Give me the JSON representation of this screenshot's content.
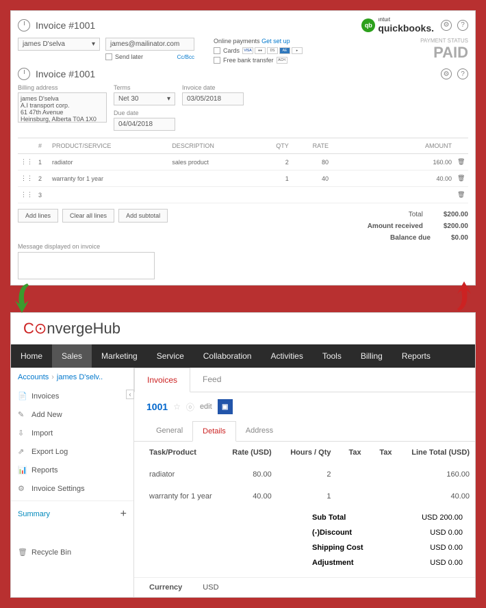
{
  "qb": {
    "title": "Invoice #1001",
    "logo": {
      "badge": "qb",
      "text1": "ıntuıt",
      "text2": "quickbooks."
    },
    "customer": "james D'selva",
    "email": "james@mailinator.com",
    "send_later": "Send later",
    "ccbcc": "Cc/Bcc",
    "online": {
      "title": "Online payments",
      "link": "Get set up",
      "cards_label": "Cards",
      "bank_label": "Free bank transfer"
    },
    "status_label": "PAYMENT STATUS",
    "status_value": "PAID",
    "billing_label": "Billing address",
    "billing_value": "james D'selva\nA.I transport corp.\n61 47th Avenue\nHeinsburg, Alberta  T0A 1X0",
    "terms_label": "Terms",
    "terms_value": "Net 30",
    "invoice_date_label": "Invoice date",
    "invoice_date": "03/05/2018",
    "due_date_label": "Due date",
    "due_date": "04/04/2018",
    "cols": {
      "num": "#",
      "prod": "PRODUCT/SERVICE",
      "desc": "DESCRIPTION",
      "qty": "QTY",
      "rate": "RATE",
      "amount": "AMOUNT"
    },
    "lines": [
      {
        "n": "1",
        "prod": "radiator",
        "desc": "sales product",
        "qty": "2",
        "rate": "80",
        "amount": "160.00"
      },
      {
        "n": "2",
        "prod": "warranty for 1 year",
        "desc": "",
        "qty": "1",
        "rate": "40",
        "amount": "40.00"
      },
      {
        "n": "3",
        "prod": "",
        "desc": "",
        "qty": "",
        "rate": "",
        "amount": ""
      }
    ],
    "btn_add_lines": "Add lines",
    "btn_clear": "Clear all lines",
    "btn_subtotal": "Add subtotal",
    "totals": {
      "total_label": "Total",
      "total": "$200.00",
      "received_label": "Amount received",
      "received": "$200.00",
      "balance_label": "Balance due",
      "balance": "$0.00"
    },
    "msg_label": "Message displayed on invoice"
  },
  "ch": {
    "logo": {
      "c": "C",
      "o": "⊙",
      "rest": "nvergeHub"
    },
    "nav": [
      "Home",
      "Sales",
      "Marketing",
      "Service",
      "Collaboration",
      "Activities",
      "Tools",
      "Billing",
      "Reports"
    ],
    "nav_active": 1,
    "crumb": {
      "a": "Accounts",
      "b": "james D'selv.."
    },
    "sidebar": [
      {
        "icon": "📄",
        "label": "Invoices"
      },
      {
        "icon": "✎",
        "label": "Add New"
      },
      {
        "icon": "⇩",
        "label": "Import"
      },
      {
        "icon": "⇗",
        "label": "Export Log"
      },
      {
        "icon": "📊",
        "label": "Reports"
      },
      {
        "icon": "⚙",
        "label": "Invoice Settings"
      }
    ],
    "summary": "Summary",
    "recycle": "Recycle Bin",
    "tabs1": [
      "Invoices",
      "Feed"
    ],
    "tabs1_active": 0,
    "inv_num": "1001",
    "edit": "edit",
    "tabs2": [
      "General",
      "Details",
      "Address"
    ],
    "tabs2_active": 1,
    "cols": {
      "prod": "Task/Product",
      "rate": "Rate (USD)",
      "qty": "Hours / Qty",
      "tax1": "Tax",
      "tax2": "Tax",
      "total": "Line Total (USD)"
    },
    "lines": [
      {
        "prod": "radiator",
        "rate": "80.00",
        "qty": "2",
        "total": "160.00"
      },
      {
        "prod": "warranty for 1 year",
        "rate": "40.00",
        "qty": "1",
        "total": "40.00"
      }
    ],
    "totals": [
      {
        "label": "Sub Total",
        "val": "USD 200.00"
      },
      {
        "label": "(-)Discount",
        "val": "USD 0.00"
      },
      {
        "label": "Shipping Cost",
        "val": "USD 0.00"
      },
      {
        "label": "Adjustment",
        "val": "USD 0.00"
      }
    ],
    "currency_label": "Currency",
    "currency_value": "USD"
  }
}
